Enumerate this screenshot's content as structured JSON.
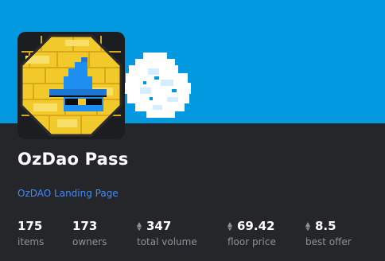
{
  "banner": {
    "color": "#0299e0"
  },
  "collection": {
    "name": "OzDao Pass",
    "link_text": "OzDAO Landing Page",
    "link_color": "#3d8bff"
  },
  "stats": [
    {
      "value": "175",
      "label": "items",
      "currency_icon": ""
    },
    {
      "value": "173",
      "label": "owners",
      "currency_icon": ""
    },
    {
      "value": "347",
      "label": "total volume",
      "currency_icon": "eth-icon"
    },
    {
      "value": "69.42",
      "label": "floor price",
      "currency_icon": "eth-icon"
    },
    {
      "value": "8.5",
      "label": "best offer",
      "currency_icon": "eth-icon"
    }
  ]
}
